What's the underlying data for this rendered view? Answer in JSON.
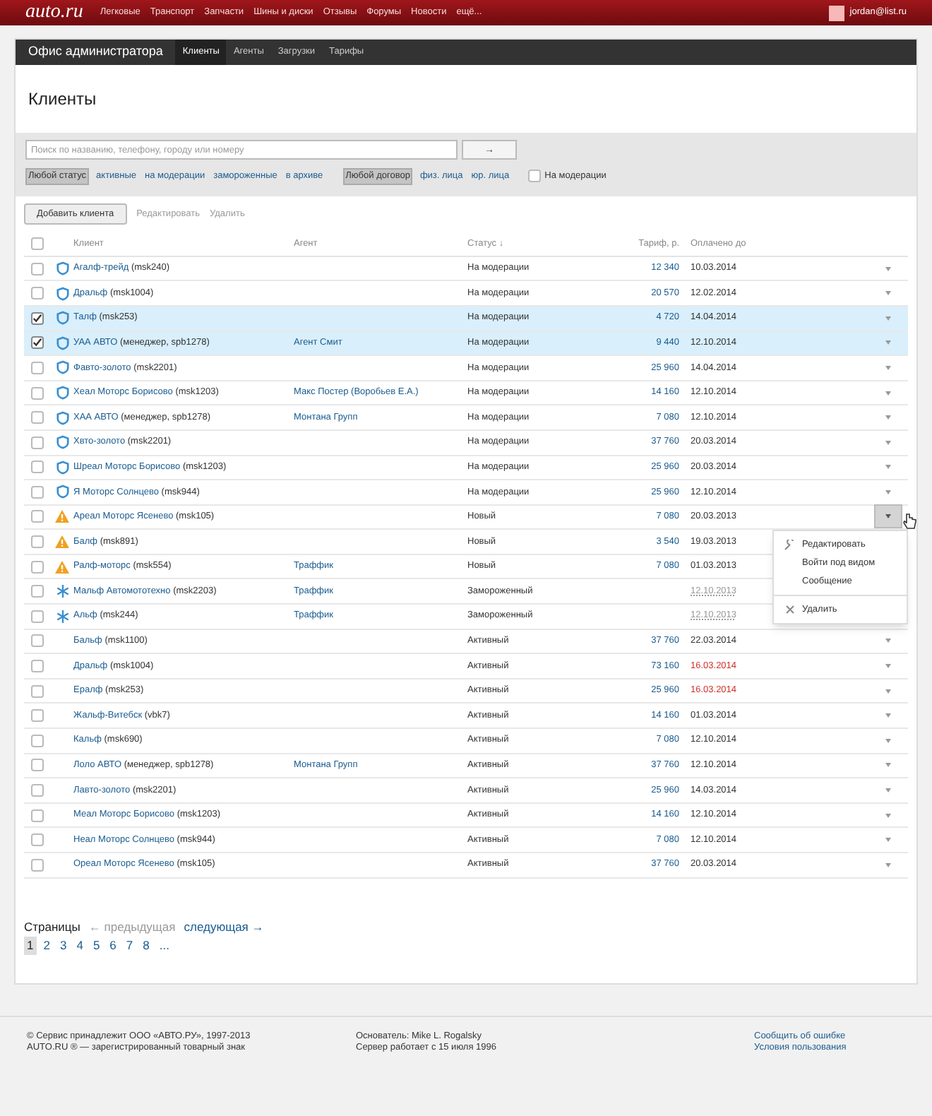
{
  "topbar": {
    "logo": "auto.ru",
    "links": [
      "Легковые",
      "Транспорт",
      "Запчасти",
      "Шины и диски",
      "Отзывы",
      "Форумы",
      "Новости",
      "ещё..."
    ],
    "user": "jordan@list.ru"
  },
  "office": {
    "title": "Офис администратора",
    "tabs": [
      {
        "label": "Клиенты",
        "selected": true
      },
      {
        "label": "Агенты",
        "selected": false
      },
      {
        "label": "Загрузки",
        "selected": false
      },
      {
        "label": "Тарифы",
        "selected": false
      }
    ]
  },
  "page_title": "Клиенты",
  "search": {
    "placeholder": "Поиск по названию, телефону, городу или номеру",
    "button": "→"
  },
  "status_filters": [
    {
      "label": "Любой статус",
      "selected": true
    },
    {
      "label": "активные",
      "selected": false
    },
    {
      "label": "на модерации",
      "selected": false
    },
    {
      "label": "замороженные",
      "selected": false
    },
    {
      "label": "в архиве",
      "selected": false
    }
  ],
  "contract_filters": [
    {
      "label": "Любой договор",
      "selected": true
    },
    {
      "label": "физ. лица",
      "selected": false
    },
    {
      "label": "юр. лица",
      "selected": false
    }
  ],
  "moderation_checkbox": {
    "label": "На модерации",
    "checked": false
  },
  "toolbar": {
    "add": "Добавить клиента",
    "edit": "Редактировать",
    "delete": "Удалить"
  },
  "table": {
    "select_all": {
      "checked": false
    },
    "columns": [
      "Клиент",
      "Агент",
      "Статус ↓",
      "Тариф, р.",
      "Оплачено до"
    ],
    "rows": [
      {
        "kind": "shield",
        "name": "Агалф-трейд",
        "code": "(msk240)",
        "agent": "",
        "status": "На модерации",
        "tariff": "12 340",
        "paid": "10.03.2014",
        "overdue": false,
        "checked": false,
        "menu_open": false
      },
      {
        "kind": "shield",
        "name": "Дральф",
        "code": "(msk1004)",
        "agent": "",
        "status": "На модерации",
        "tariff": "20 570",
        "paid": "12.02.2014",
        "overdue": false,
        "checked": false,
        "menu_open": false
      },
      {
        "kind": "shield",
        "name": "Талф",
        "code": "(msk253)",
        "agent": "",
        "status": "На модерации",
        "tariff": "4 720",
        "paid": "14.04.2014",
        "overdue": false,
        "checked": true,
        "menu_open": false
      },
      {
        "kind": "shield",
        "name": "УАА АВТО",
        "code": "(менеджер, spb1278)",
        "agent": "Агент Смит",
        "status": "На модерации",
        "tariff": "9 440",
        "paid": "12.10.2014",
        "overdue": false,
        "checked": true,
        "menu_open": false
      },
      {
        "kind": "shield",
        "name": "Фавто-золото",
        "code": "(msk2201)",
        "agent": "",
        "status": "На модерации",
        "tariff": "25 960",
        "paid": "14.04.2014",
        "overdue": false,
        "checked": false,
        "menu_open": false
      },
      {
        "kind": "shield",
        "name": "Хеал Моторс Борисово",
        "code": "(msk1203)",
        "agent": "Макс Постер (Воробьев Е.А.)",
        "status": "На модерации",
        "tariff": "14 160",
        "paid": "12.10.2014",
        "overdue": false,
        "checked": false,
        "menu_open": false
      },
      {
        "kind": "shield",
        "name": "ХАА АВТО",
        "code": "(менеджер, spb1278)",
        "agent": "Монтана Групп",
        "status": "На модерации",
        "tariff": "7 080",
        "paid": "12.10.2014",
        "overdue": false,
        "checked": false,
        "menu_open": false
      },
      {
        "kind": "shield",
        "name": "Хвто-золото",
        "code": "(msk2201)",
        "agent": "",
        "status": "На модерации",
        "tariff": "37 760",
        "paid": "20.03.2014",
        "overdue": false,
        "checked": false,
        "menu_open": false
      },
      {
        "kind": "shield",
        "name": "Шреал Моторс Борисово",
        "code": "(msk1203)",
        "agent": "",
        "status": "На модерации",
        "tariff": "25 960",
        "paid": "20.03.2014",
        "overdue": false,
        "checked": false,
        "menu_open": false
      },
      {
        "kind": "shield",
        "name": "Я Моторс Солнцево",
        "code": "(msk944)",
        "agent": "",
        "status": "На модерации",
        "tariff": "25 960",
        "paid": "12.10.2014",
        "overdue": false,
        "checked": false,
        "menu_open": false
      },
      {
        "kind": "warning",
        "name": "Ареал Моторс Ясенево",
        "code": "(msk105)",
        "agent": "",
        "status": "Новый",
        "tariff": "7 080",
        "paid": "20.03.2013",
        "overdue": false,
        "checked": false,
        "menu_open": true
      },
      {
        "kind": "warning",
        "name": "Балф",
        "code": "(msk891)",
        "agent": "",
        "status": "Новый",
        "tariff": "3 540",
        "paid": "19.03.2013",
        "overdue": false,
        "checked": false,
        "menu_open": false
      },
      {
        "kind": "warning",
        "name": "Ралф-моторс",
        "code": "(msk554)",
        "agent": "Траффик",
        "status": "Новый",
        "tariff": "7 080",
        "paid": "01.03.2013",
        "overdue": false,
        "checked": false,
        "menu_open": false
      },
      {
        "kind": "frozen",
        "name": "Мальф Автомототехно",
        "code": "(msk2203)",
        "agent": "Траффик",
        "status": "Замороженный",
        "tariff": "",
        "paid": "12.10.2013",
        "overdue": false,
        "checked": false,
        "menu_open": false
      },
      {
        "kind": "frozen",
        "name": "Альф",
        "code": "(msk244)",
        "agent": "Траффик",
        "status": "Замороженный",
        "tariff": "",
        "paid": "12.10.2013",
        "overdue": false,
        "checked": false,
        "menu_open": false
      },
      {
        "kind": "active",
        "name": "Бальф",
        "code": "(msk1100)",
        "agent": "",
        "status": "Активный",
        "tariff": "37 760",
        "paid": "22.03.2014",
        "overdue": false,
        "checked": false,
        "menu_open": false
      },
      {
        "kind": "active",
        "name": "Дральф",
        "code": "(msk1004)",
        "agent": "",
        "status": "Активный",
        "tariff": "73 160",
        "paid": "16.03.2014",
        "overdue": true,
        "checked": false,
        "menu_open": false
      },
      {
        "kind": "active",
        "name": "Ералф",
        "code": "(msk253)",
        "agent": "",
        "status": "Активный",
        "tariff": "25 960",
        "paid": "16.03.2014",
        "overdue": true,
        "checked": false,
        "menu_open": false
      },
      {
        "kind": "active",
        "name": "Жальф-Витебск",
        "code": "(vbk7)",
        "agent": "",
        "status": "Активный",
        "tariff": "14 160",
        "paid": "01.03.2014",
        "overdue": false,
        "checked": false,
        "menu_open": false
      },
      {
        "kind": "active",
        "name": "Кальф",
        "code": "(msk690)",
        "agent": "",
        "status": "Активный",
        "tariff": "7 080",
        "paid": "12.10.2014",
        "overdue": false,
        "checked": false,
        "menu_open": false
      },
      {
        "kind": "active",
        "name": "Лоло АВТО",
        "code": "(менеджер, spb1278)",
        "agent": "Монтана Групп",
        "status": "Активный",
        "tariff": "37 760",
        "paid": "12.10.2014",
        "overdue": false,
        "checked": false,
        "menu_open": false
      },
      {
        "kind": "active",
        "name": "Лавто-золото",
        "code": "(msk2201)",
        "agent": "",
        "status": "Активный",
        "tariff": "25 960",
        "paid": "14.03.2014",
        "overdue": false,
        "checked": false,
        "menu_open": false
      },
      {
        "kind": "active",
        "name": "Меал Моторс Борисово",
        "code": "(msk1203)",
        "agent": "",
        "status": "Активный",
        "tariff": "14 160",
        "paid": "12.10.2014",
        "overdue": false,
        "checked": false,
        "menu_open": false
      },
      {
        "kind": "active",
        "name": "Неал Моторс Солнцево",
        "code": "(msk944)",
        "agent": "",
        "status": "Активный",
        "tariff": "7 080",
        "paid": "12.10.2014",
        "overdue": false,
        "checked": false,
        "menu_open": false
      },
      {
        "kind": "active",
        "name": "Ореал Моторс Ясенево",
        "code": "(msk105)",
        "agent": "",
        "status": "Активный",
        "tariff": "37 760",
        "paid": "20.03.2014",
        "overdue": false,
        "checked": false,
        "menu_open": false
      }
    ]
  },
  "row_menu": [
    {
      "kind": "edit",
      "label": "Редактировать"
    },
    {
      "kind": "plain",
      "label": "Войти под видом"
    },
    {
      "kind": "plain",
      "label": "Сообщение"
    },
    {
      "kind": "delete",
      "label": "Удалить"
    }
  ],
  "pagination": {
    "label": "Страницы",
    "prev": "← предыдущая",
    "next": "следующая →",
    "pages": [
      {
        "label": "1",
        "selected": true
      },
      {
        "label": "2",
        "selected": false
      },
      {
        "label": "3",
        "selected": false
      },
      {
        "label": "4",
        "selected": false
      },
      {
        "label": "5",
        "selected": false
      },
      {
        "label": "6",
        "selected": false
      },
      {
        "label": "7",
        "selected": false
      },
      {
        "label": "8",
        "selected": false
      },
      {
        "label": "...",
        "selected": false
      }
    ]
  },
  "footer": {
    "left": [
      "© Сервис принадлежит ООО «АВТО.РУ», 1997-2013",
      "AUTO.RU ® — зарегистрированный товарный знак"
    ],
    "middle": [
      "Основатель: Mike L. Rogalsky",
      "Сервер работает с 15 июля 1996"
    ],
    "links": [
      "Сообщить об ошибке",
      "Условия пользования"
    ]
  }
}
